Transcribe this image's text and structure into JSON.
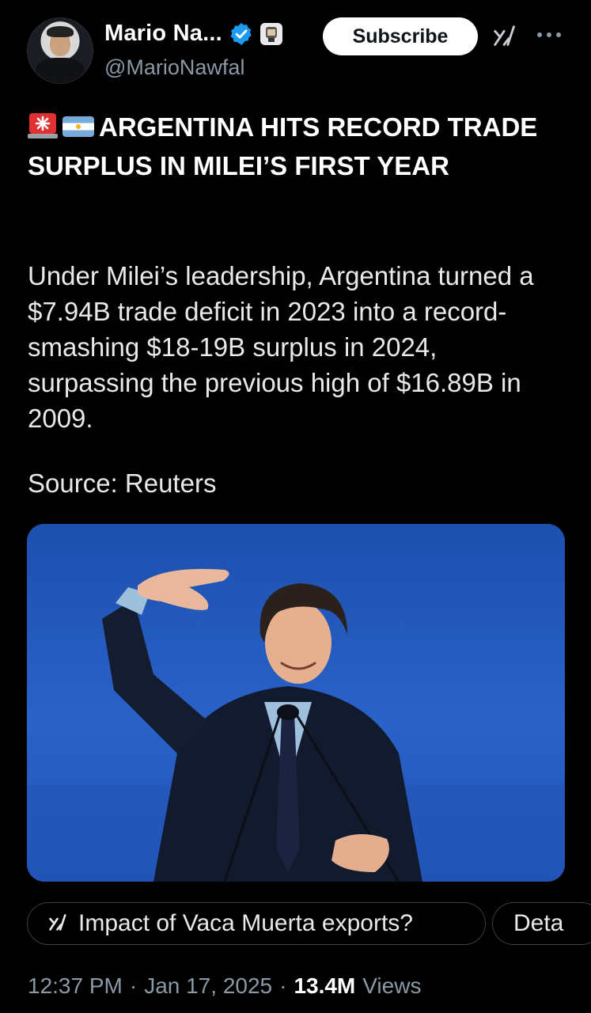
{
  "author": {
    "display_name": "Mario Na...",
    "handle": "@MarioNawfal",
    "verified": true,
    "verified_color": "#1d9bf0"
  },
  "actions": {
    "subscribe_label": "Subscribe",
    "grok_icon": "grok-icon",
    "more_icon": "more-icon"
  },
  "tweet": {
    "headline": "ARGENTINA HITS RECORD TRADE SURPLUS IN MILEI’S FIRST YEAR",
    "headline_emojis": [
      "siren-emoji",
      "argentina-flag-emoji"
    ],
    "body": "Under Milei’s leadership, Argentina turned a $7.94B trade deficit in 2023 into a record-smashing $18-19B surplus in 2024, surpassing the previous high of $16.89B in 2009.",
    "source": "Source: Reuters"
  },
  "suggestions": [
    {
      "label": "Impact of Vaca Muerta exports?",
      "icon": "grok-icon"
    },
    {
      "label": "Deta"
    }
  ],
  "meta": {
    "time": "12:37 PM",
    "separator": "·",
    "date": "Jan 17, 2025",
    "views_count": "13.4M",
    "views_label": "Views"
  }
}
